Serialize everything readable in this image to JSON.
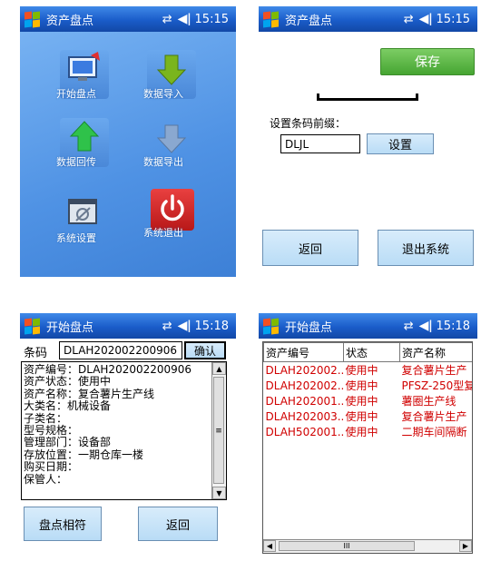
{
  "status": {
    "time1": "15:15",
    "time2": "15:15",
    "time3": "15:18",
    "time4": "15:18",
    "sync_glyph": "⇄",
    "volume_glyph": "◀ǀ"
  },
  "menu": {
    "title": "资产盘点",
    "tiles": [
      {
        "label": "开始盘点",
        "icon": "monitor-icon"
      },
      {
        "label": "数据导入",
        "icon": "down-arrow-icon"
      },
      {
        "label": "数据回传",
        "icon": "up-arrow-icon"
      },
      {
        "label": "数据导出",
        "icon": "down-arrow-gray-icon"
      },
      {
        "label": "系统设置",
        "icon": "settings-window-icon"
      },
      {
        "label": "系统退出",
        "icon": "power-icon"
      }
    ]
  },
  "settings": {
    "title": "资产盘点",
    "save_label": "保存",
    "prefix_label": "设置条码前缀：",
    "prefix_value": "DLJL",
    "set_label": "设置",
    "back_label": "返回",
    "exit_label": "退出系统"
  },
  "scan": {
    "title": "开始盘点",
    "barcode_label": "条码",
    "barcode_value": "DLAH202002200906",
    "confirm_label": "确认",
    "details": [
      "资产编号：DLAH202002200906",
      "资产状态：使用中",
      "资产名称：复合薯片生产线",
      "大类名：机械设备",
      "子类名：",
      "型号规格：",
      "管理部门：设备部",
      "存放位置：一期仓库一楼",
      "购买日期：",
      "保管人："
    ],
    "match_label": "盘点相符",
    "back_label": "返回"
  },
  "list": {
    "title": "开始盘点",
    "headers": [
      "资产编号",
      "状态",
      "资产名称"
    ],
    "rows": [
      [
        "DLAH202002...",
        "使用中",
        "复合薯片生产"
      ],
      [
        "DLAH202002...",
        "使用中",
        "PFSZ-250型复"
      ],
      [
        "DLAH202001...",
        "使用中",
        "薯圈生产线"
      ],
      [
        "DLAH202003...",
        "使用中",
        "复合薯片生产"
      ],
      [
        "DLAH502001...",
        "使用中",
        "二期车间隔断"
      ]
    ],
    "scroll_left": "◀",
    "scroll_mid": "III",
    "scroll_right": "▶"
  }
}
